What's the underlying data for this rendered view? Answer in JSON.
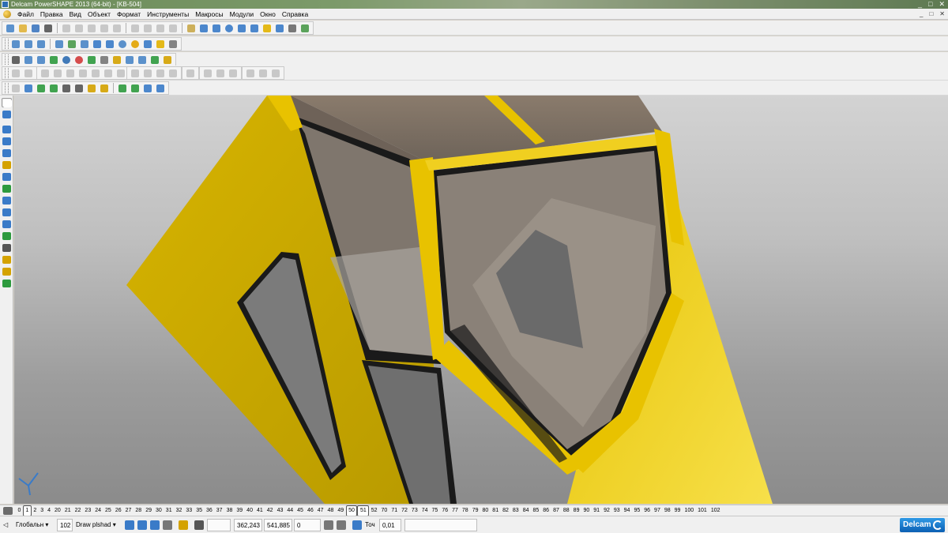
{
  "window": {
    "title": "Delcam PowerSHAPE 2013 (64-bit) - [KB-504]",
    "controls": [
      "_",
      "□",
      "✕"
    ]
  },
  "menu": {
    "items": [
      "Файл",
      "Правка",
      "Вид",
      "Объект",
      "Формат",
      "Инструменты",
      "Макросы",
      "Модули",
      "Окно",
      "Справка"
    ],
    "mdi_controls": [
      "_",
      "□",
      "✕"
    ]
  },
  "level_bar": {
    "levels": [
      "0",
      "1",
      "2",
      "3",
      "4",
      "20",
      "21",
      "22",
      "23",
      "24",
      "25",
      "26",
      "27",
      "28",
      "29",
      "30",
      "31",
      "32",
      "33",
      "35",
      "36",
      "37",
      "38",
      "39",
      "40",
      "41",
      "42",
      "43",
      "44",
      "45",
      "46",
      "47",
      "48",
      "49",
      "50",
      "51",
      "52",
      "70",
      "71",
      "72",
      "73",
      "74",
      "75",
      "76",
      "77",
      "78",
      "79",
      "80",
      "81",
      "82",
      "83",
      "84",
      "85",
      "86",
      "87",
      "88",
      "89",
      "90",
      "91",
      "92",
      "93",
      "94",
      "95",
      "96",
      "97",
      "98",
      "99",
      "100",
      "101",
      "102"
    ],
    "active_levels": [
      "1",
      "50",
      "51"
    ]
  },
  "status": {
    "workplane": "Глобальн",
    "level": "102",
    "render_mode": "Draw plshad",
    "coord_x": "362,243",
    "coord_y": "541,885",
    "coord_z": "0",
    "tolerance_label": "Точ",
    "tolerance_value": "0,01",
    "brand": "Delcam"
  },
  "colors": {
    "cab_yellow": "#e8c200",
    "cab_yellow_dark": "#b89a00",
    "glass": "#767676",
    "frame_black": "#1a1a1a"
  }
}
